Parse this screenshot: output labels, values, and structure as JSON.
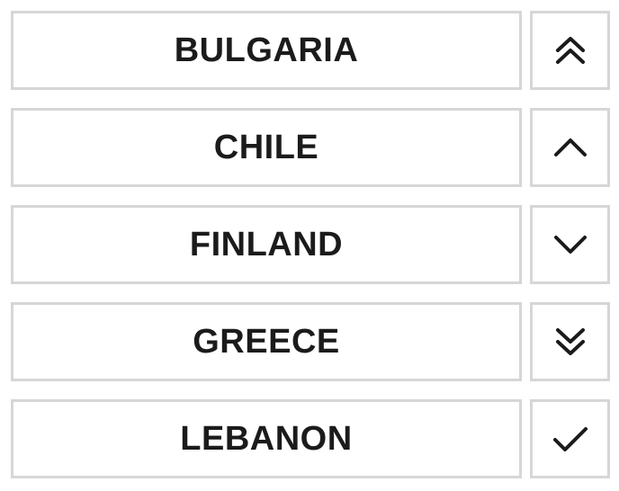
{
  "rows": [
    {
      "label": "BULGARIA",
      "icon": "double-chevron-up-icon"
    },
    {
      "label": "CHILE",
      "icon": "chevron-up-icon"
    },
    {
      "label": "FINLAND",
      "icon": "chevron-down-icon"
    },
    {
      "label": "GREECE",
      "icon": "double-chevron-down-icon"
    },
    {
      "label": "LEBANON",
      "icon": "checkmark-icon"
    }
  ]
}
